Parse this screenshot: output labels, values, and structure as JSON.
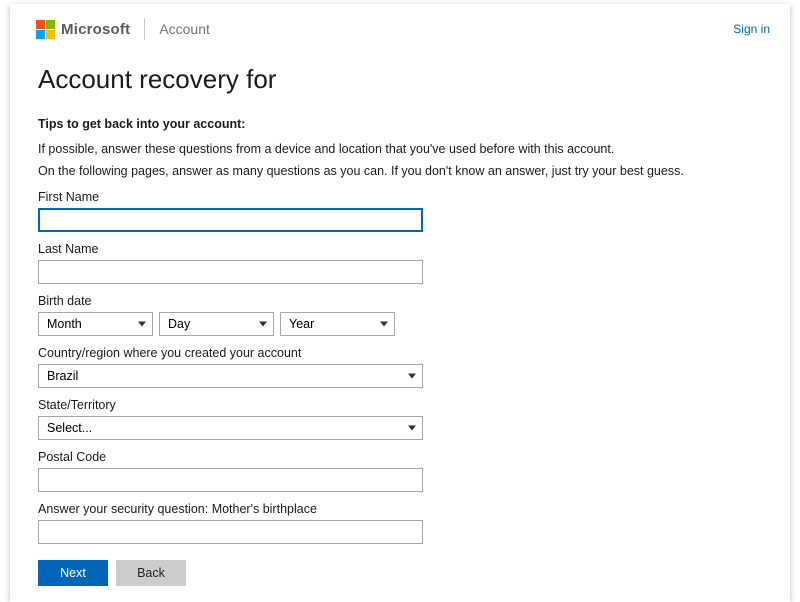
{
  "header": {
    "brand": "Microsoft",
    "section": "Account",
    "signin": "Sign in"
  },
  "title": "Account recovery for",
  "tips": {
    "heading": "Tips to get back into your account:",
    "line1": "If possible, answer these questions from a device and location that you've used before with this account.",
    "line2": "On the following pages, answer as many questions as you can. If you don't know an answer, just try your best guess."
  },
  "form": {
    "first_name": {
      "label": "First Name",
      "value": ""
    },
    "last_name": {
      "label": "Last Name",
      "value": ""
    },
    "birth_date": {
      "label": "Birth date",
      "month": "Month",
      "day": "Day",
      "year": "Year"
    },
    "country": {
      "label": "Country/region where you created your account",
      "value": "Brazil"
    },
    "state": {
      "label": "State/Territory",
      "value": "Select..."
    },
    "postal": {
      "label": "Postal Code",
      "value": ""
    },
    "security": {
      "label": "Answer your security question: Mother's birthplace",
      "value": ""
    }
  },
  "buttons": {
    "next": "Next",
    "back": "Back"
  }
}
